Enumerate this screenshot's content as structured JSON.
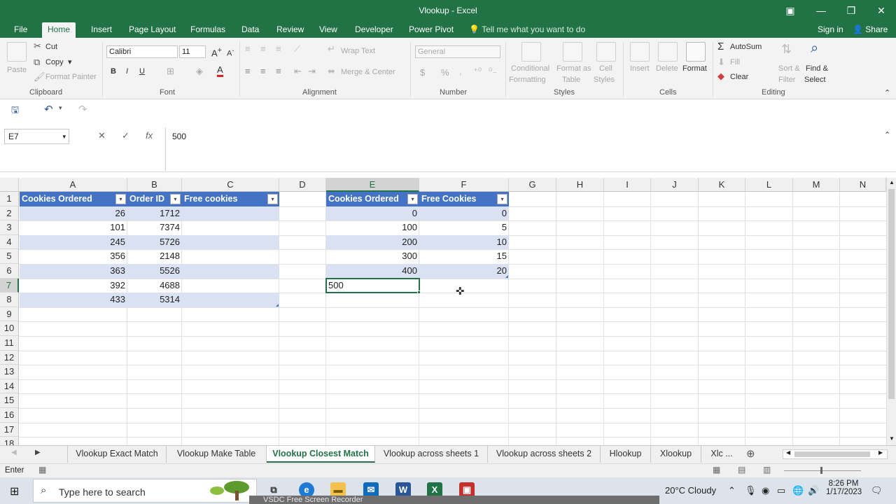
{
  "window": {
    "title": "Vlookup - Excel"
  },
  "ribbon_tabs": [
    "File",
    "Home",
    "Insert",
    "Page Layout",
    "Formulas",
    "Data",
    "Review",
    "View",
    "Developer",
    "Power Pivot"
  ],
  "tell_me": "Tell me what you want to do",
  "account": {
    "signin": "Sign in",
    "share": "Share"
  },
  "clipboard": {
    "paste": "Paste",
    "cut": "Cut",
    "copy": "Copy",
    "format_painter": "Format Painter",
    "label": "Clipboard"
  },
  "font": {
    "name": "Calibri",
    "size": "11",
    "label": "Font",
    "bold": "B",
    "italic": "I",
    "underline": "U"
  },
  "alignment": {
    "wrap": "Wrap Text",
    "merge": "Merge & Center",
    "label": "Alignment"
  },
  "number": {
    "format": "General",
    "label": "Number",
    "currency": "$",
    "percent": "%"
  },
  "styles": {
    "conditional_1": "Conditional",
    "conditional_2": "Formatting",
    "format_table_1": "Format as",
    "format_table_2": "Table",
    "cell_styles_1": "Cell",
    "cell_styles_2": "Styles",
    "label": "Styles"
  },
  "cells": {
    "insert": "Insert",
    "delete": "Delete",
    "format": "Format",
    "label": "Cells"
  },
  "editing": {
    "autosum": "AutoSum",
    "fill": "Fill",
    "clear": "Clear",
    "sort_1": "Sort &",
    "sort_2": "Filter",
    "find_1": "Find &",
    "find_2": "Select",
    "label": "Editing"
  },
  "formula_bar": {
    "name_box": "E7",
    "value": "500",
    "fx": "fx"
  },
  "columns": [
    "A",
    "B",
    "C",
    "D",
    "E",
    "F",
    "G",
    "H",
    "I",
    "J",
    "K",
    "L",
    "M",
    "N"
  ],
  "rows": [
    "1",
    "2",
    "3",
    "4",
    "5",
    "6",
    "7",
    "8",
    "9",
    "10",
    "11",
    "12",
    "13",
    "14",
    "15",
    "16",
    "17",
    "18"
  ],
  "table1": {
    "headers": [
      "Cookies Ordered",
      "Order ID",
      "Free cookies"
    ],
    "rows": [
      [
        "26",
        "1712",
        ""
      ],
      [
        "101",
        "7374",
        ""
      ],
      [
        "245",
        "5726",
        ""
      ],
      [
        "356",
        "2148",
        ""
      ],
      [
        "363",
        "5526",
        ""
      ],
      [
        "392",
        "4688",
        ""
      ],
      [
        "433",
        "5314",
        ""
      ]
    ]
  },
  "table2": {
    "headers": [
      "Cookies Ordered",
      "Free Cookies"
    ],
    "rows": [
      [
        "0",
        "0"
      ],
      [
        "100",
        "5"
      ],
      [
        "200",
        "10"
      ],
      [
        "300",
        "15"
      ],
      [
        "400",
        "20"
      ]
    ]
  },
  "active_cell_value": "500",
  "sheet_tabs": [
    "Vlookup Exact Match",
    "Vlookup Make Table",
    "Vlookup Closest Match",
    "Vlookup across sheets 1",
    "Vlookup across sheets 2",
    "Hlookup",
    "Xlookup",
    "Xlc ..."
  ],
  "active_sheet": "Vlookup Closest Match",
  "status": {
    "mode": "Enter"
  },
  "taskbar": {
    "search_placeholder": "Type here to search",
    "recorder": "VSDC Free Screen Recorder",
    "weather": "20°C  Cloudy",
    "time": "8:26 PM",
    "date": "1/17/2023"
  }
}
